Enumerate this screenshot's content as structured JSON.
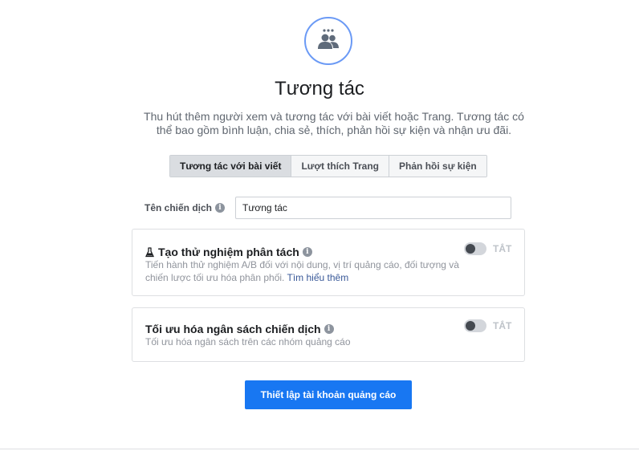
{
  "objective": {
    "icon": "engagement-people-icon",
    "title": "Tương tác",
    "description": "Thu hút thêm người xem và tương tác với bài viết hoặc Trang. Tương tác có thể bao gồm bình luận, chia sẻ, thích, phản hồi sự kiện và nhận ưu đãi."
  },
  "tabs": [
    {
      "label": "Tương tác với bài viết",
      "active": true
    },
    {
      "label": "Lượt thích Trang",
      "active": false
    },
    {
      "label": "Phản hồi sự kiện",
      "active": false
    }
  ],
  "campaign_name": {
    "label": "Tên chiến dịch",
    "value": "Tương tác"
  },
  "split_test": {
    "title": "Tạo thử nghiệm phân tách",
    "description": "Tiến hành thử nghiệm A/B đối với nội dung, vị trí quảng cáo, đối tượng và chiến lược tối ưu hóa phân phối.",
    "link": "Tìm hiểu thêm",
    "toggle_label": "TẮT",
    "enabled": false
  },
  "budget_optimization": {
    "title": "Tối ưu hóa ngân sách chiến dịch",
    "description": "Tối ưu hóa ngân sách trên các nhóm quảng cáo",
    "toggle_label": "TẮT",
    "enabled": false
  },
  "setup_button": "Thiết lập tài khoản quảng cáo",
  "colors": {
    "accent": "#1877f2",
    "icon_ring": "#6b9af5",
    "link": "#385898"
  }
}
